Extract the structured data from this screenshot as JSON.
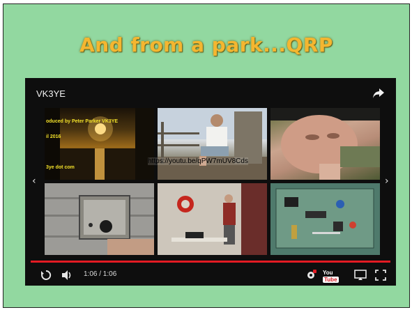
{
  "slide": {
    "title": "And from a park...QRP",
    "background": "#92d8a0",
    "title_color": "#f4b630"
  },
  "player": {
    "channel_name": "VK3YE",
    "share_icon": "share-icon",
    "video_credit_line1": "oduced by Peter Parker VK3YE",
    "video_credit_line2": "il 2016",
    "video_credit_line3": "3ye dot com",
    "video_url": "https://youtu.be/qPW7mUV8Cds",
    "prev_icon": "chevron-left-icon",
    "next_icon": "chevron-right-icon",
    "time_display": "1:06 / 1:06",
    "progress": 1.0,
    "controls": {
      "replay_icon": "replay-icon",
      "volume_icon": "volume-icon",
      "settings_icon": "settings-icon",
      "youtube_logo_left": "You",
      "youtube_logo_right": "Tube",
      "cast_icon": "cast-icon",
      "fullscreen_icon": "fullscreen-icon"
    },
    "accent": "#e31b23"
  }
}
